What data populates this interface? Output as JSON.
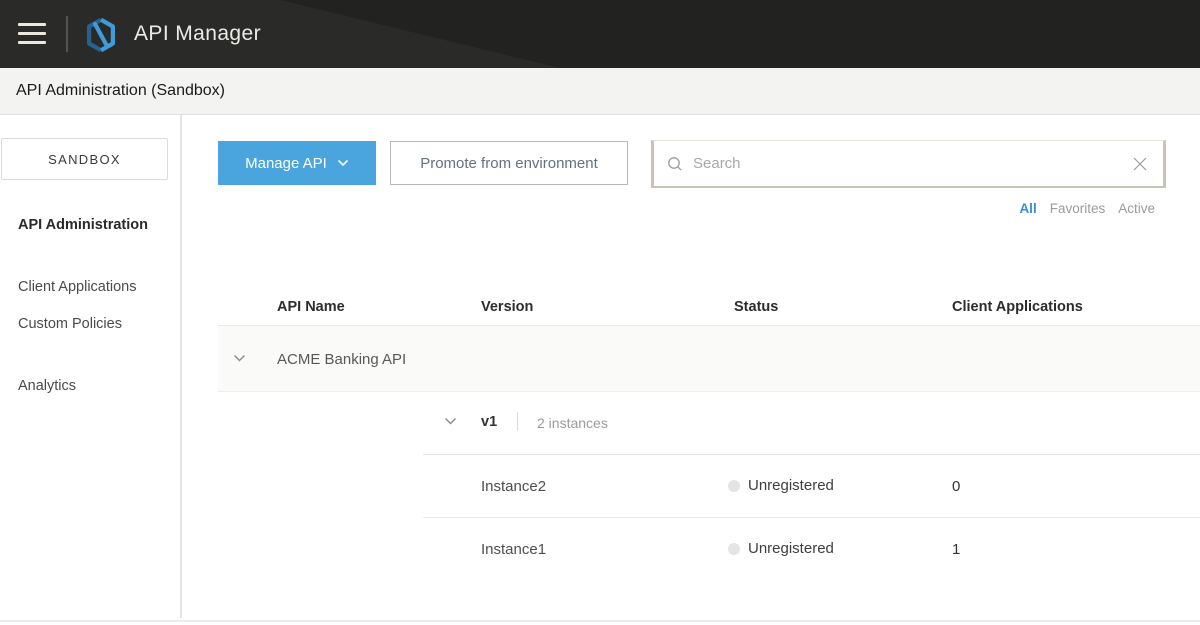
{
  "header": {
    "app_title": "API Manager"
  },
  "breadcrumb": {
    "title": "API Administration (Sandbox)"
  },
  "sidebar": {
    "environment": "SANDBOX",
    "items": [
      {
        "label": "API Administration",
        "active": true
      },
      {
        "label": "Client Applications",
        "active": false
      },
      {
        "label": "Custom Policies",
        "active": false
      },
      {
        "label": "Analytics",
        "active": false
      }
    ]
  },
  "toolbar": {
    "manage_api_label": "Manage API",
    "promote_label": "Promote from environment",
    "search_placeholder": "Search",
    "search_value": ""
  },
  "filters": {
    "options": [
      "All",
      "Favorites",
      "Active"
    ],
    "selected": "All"
  },
  "table": {
    "columns": [
      "API Name",
      "Version",
      "Status",
      "Client Applications"
    ],
    "api": {
      "name": "ACME Banking API",
      "version": {
        "name": "v1",
        "instances_label": "2 instances"
      },
      "instances": [
        {
          "name": "Instance2",
          "status": "Unregistered",
          "client_applications": "0"
        },
        {
          "name": "Instance1",
          "status": "Unregistered",
          "client_applications": "1"
        }
      ]
    }
  },
  "colors": {
    "header_bg": "#2a2a28",
    "accent_blue": "#4aa4dd",
    "link_blue": "#3a8dd3",
    "logo_dark_blue": "#27618f",
    "logo_light_blue": "#3f9cd8",
    "status_dot_gray": "#e4e4e2",
    "subheader_bg": "#f3f3f2"
  }
}
